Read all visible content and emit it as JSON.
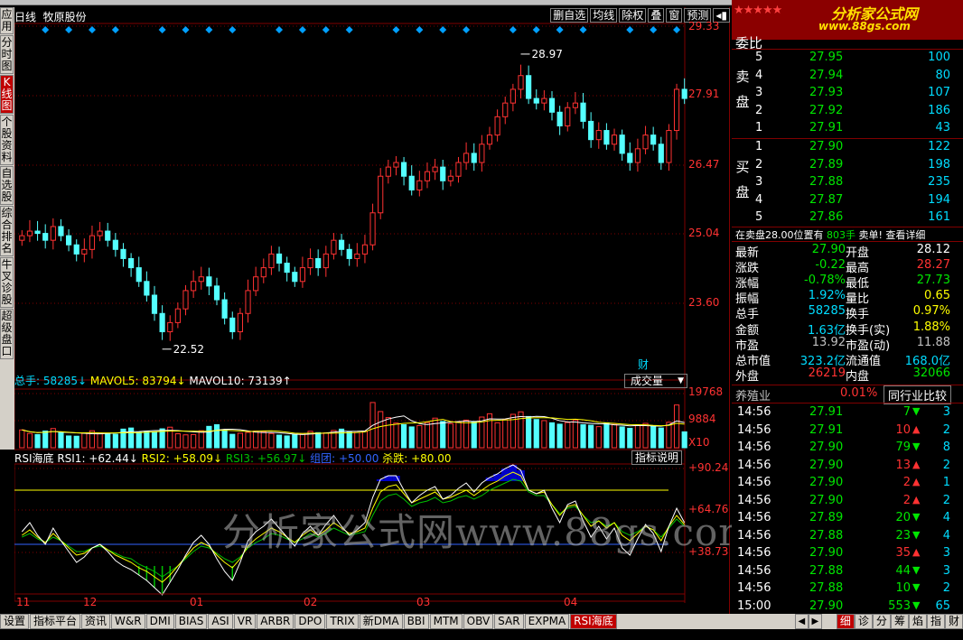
{
  "stock": {
    "period": "日线",
    "name": "牧原股份"
  },
  "left_tabs": [
    {
      "label": "应用",
      "active": false
    },
    {
      "label": "分时图",
      "active": false
    },
    {
      "label": "K线图",
      "active": true
    },
    {
      "label": "个股资料",
      "active": false
    },
    {
      "label": "自选股",
      "active": false
    },
    {
      "label": "综合排名",
      "active": false
    },
    {
      "label": "牛叉诊股",
      "active": false
    },
    {
      "label": "超级盘口",
      "active": false
    }
  ],
  "toolbar": [
    "删自选",
    "均线",
    "除权",
    "叠",
    "窗",
    "预测",
    "◂▮"
  ],
  "price_axis": [
    "29.33",
    "27.91",
    "26.47",
    "25.04",
    "23.60"
  ],
  "annotations": {
    "high": "28.97",
    "low": "22.52",
    "cai": "财"
  },
  "volume": {
    "header": [
      {
        "text": "总手: 58285↓",
        "color": "#00dcff"
      },
      {
        "text": " MAVOL5: 83794↓",
        "color": "#ffff00"
      },
      {
        "text": " MAVOL10: 73139↑",
        "color": "#ffffff"
      }
    ],
    "dropdown": "成交量",
    "axis": [
      "19768",
      "9884"
    ],
    "unit": "X10"
  },
  "rsi": {
    "header": [
      {
        "text": "RSI海底",
        "color": "#ffffff"
      },
      {
        "text": " RSI1: +62.44↓",
        "color": "#ffffff"
      },
      {
        "text": " RSI2: +58.09↓",
        "color": "#ffff00"
      },
      {
        "text": " RSI3: +56.97↓",
        "color": "#00c000"
      },
      {
        "text": " 组团: +50.00",
        "color": "#3264ff"
      },
      {
        "text": " 杀跌: +80.00",
        "color": "#ffff00"
      }
    ],
    "help": "指标说明",
    "axis": [
      "+90.24",
      "+64.76",
      "+38.73"
    ]
  },
  "watermark": "分析家公式网www.88gs.com",
  "dates": [
    "11",
    "12",
    "01",
    "02",
    "03",
    "04"
  ],
  "bottom_tabs": [
    "设置",
    "指标平台",
    "资讯",
    "W&R",
    "DMI",
    "BIAS",
    "ASI",
    "VR",
    "ARBR",
    "DPO",
    "TRIX",
    "新DMA",
    "BBI",
    "MTM",
    "OBV",
    "SAR",
    "EXPMA",
    "RSI海底"
  ],
  "right_tabs": [
    "细",
    "诊",
    "分",
    "筹",
    "焰",
    "指",
    "财"
  ],
  "logo": {
    "stars": "★★★★★",
    "name": "分析家公式网",
    "url": "www.88gs.com"
  },
  "order_book": {
    "weibi_label": "委比",
    "sell_label": "卖盘",
    "buy_label": "买盘",
    "sell": [
      {
        "lvl": "5",
        "price": "27.95",
        "vol": "100"
      },
      {
        "lvl": "4",
        "price": "27.94",
        "vol": "80"
      },
      {
        "lvl": "3",
        "price": "27.93",
        "vol": "107"
      },
      {
        "lvl": "2",
        "price": "27.92",
        "vol": "186"
      },
      {
        "lvl": "1",
        "price": "27.91",
        "vol": "43"
      }
    ],
    "buy": [
      {
        "lvl": "1",
        "price": "27.90",
        "vol": "122"
      },
      {
        "lvl": "2",
        "price": "27.89",
        "vol": "198"
      },
      {
        "lvl": "3",
        "price": "27.88",
        "vol": "235"
      },
      {
        "lvl": "4",
        "price": "27.87",
        "vol": "194"
      },
      {
        "lvl": "5",
        "price": "27.86",
        "vol": "161"
      }
    ],
    "note_a": "在卖盘28.00位置有",
    "note_b": "803手",
    "note_c": "卖单! 查看详细"
  },
  "quote": [
    {
      "l1": "最新",
      "v1": "27.90",
      "c1": "#00e600",
      "l2": "开盘",
      "v2": "28.12",
      "c2": "#ffffff"
    },
    {
      "l1": "涨跌",
      "v1": "-0.22",
      "c1": "#00e600",
      "l2": "最高",
      "v2": "28.27",
      "c2": "#ff3232"
    },
    {
      "l1": "涨幅",
      "v1": "-0.78%",
      "c1": "#00e600",
      "l2": "最低",
      "v2": "27.73",
      "c2": "#00e600"
    },
    {
      "l1": "振幅",
      "v1": "1.92%",
      "c1": "#00dcff",
      "l2": "量比",
      "v2": "0.65",
      "c2": "#ffff00"
    },
    {
      "l1": "总手",
      "v1": "58285",
      "c1": "#00dcff",
      "l2": "换手",
      "v2": "0.97%",
      "c2": "#ffff00"
    },
    {
      "l1": "金额",
      "v1": "1.63亿",
      "c1": "#00dcff",
      "l2": "换手(实)",
      "v2": "1.88%",
      "c2": "#ffff00"
    },
    {
      "l1": "市盈",
      "v1": "13.92",
      "c1": "#c0c0c0",
      "l2": "市盈(动)",
      "v2": "11.88",
      "c2": "#c0c0c0"
    },
    {
      "l1": "总市值",
      "v1": "323.2亿",
      "c1": "#00dcff",
      "l2": "流通值",
      "v2": "168.0亿",
      "c2": "#00dcff"
    },
    {
      "l1": "外盘",
      "v1": "26219",
      "c1": "#ff3232",
      "l2": "内盘",
      "v2": "32066",
      "c2": "#00e600"
    }
  ],
  "industry": {
    "name": "养殖业",
    "change": "0.01%",
    "button": "同行业比较"
  },
  "ticks": [
    {
      "t": "14:56",
      "p": "27.91",
      "v": "7",
      "dir": "down",
      "n": "3"
    },
    {
      "t": "14:56",
      "p": "27.91",
      "v": "10",
      "dir": "up",
      "n": "2"
    },
    {
      "t": "14:56",
      "p": "27.90",
      "v": "79",
      "dir": "down",
      "n": "8"
    },
    {
      "t": "14:56",
      "p": "27.90",
      "v": "13",
      "dir": "up",
      "n": "2"
    },
    {
      "t": "14:56",
      "p": "27.90",
      "v": "2",
      "dir": "up",
      "n": "1"
    },
    {
      "t": "14:56",
      "p": "27.90",
      "v": "2",
      "dir": "up",
      "n": "2"
    },
    {
      "t": "14:56",
      "p": "27.89",
      "v": "20",
      "dir": "down",
      "n": "4"
    },
    {
      "t": "14:56",
      "p": "27.88",
      "v": "23",
      "dir": "down",
      "n": "4"
    },
    {
      "t": "14:56",
      "p": "27.90",
      "v": "35",
      "dir": "up",
      "n": "3"
    },
    {
      "t": "14:56",
      "p": "27.88",
      "v": "44",
      "dir": "down",
      "n": "3"
    },
    {
      "t": "14:56",
      "p": "27.88",
      "v": "10",
      "dir": "down",
      "n": "2"
    },
    {
      "t": "15:00",
      "p": "27.90",
      "v": "553",
      "dir": "down",
      "n": "65"
    }
  ],
  "chart_data": {
    "type": "candlestick",
    "title": "牧原股份 日线",
    "price_range": [
      22.52,
      28.97
    ],
    "closes": [
      25.0,
      25.1,
      25.05,
      24.9,
      25.2,
      25.0,
      24.8,
      24.6,
      24.7,
      25.0,
      25.1,
      24.9,
      24.7,
      24.5,
      24.3,
      24.0,
      23.7,
      23.3,
      22.9,
      23.1,
      23.4,
      23.8,
      24.0,
      24.1,
      23.9,
      23.6,
      23.2,
      22.9,
      23.3,
      23.8,
      24.1,
      24.3,
      24.6,
      24.4,
      24.2,
      24.0,
      24.3,
      24.5,
      24.3,
      24.6,
      24.9,
      24.7,
      24.5,
      24.6,
      24.8,
      25.5,
      26.3,
      26.5,
      26.6,
      26.3,
      26.0,
      26.2,
      26.4,
      26.5,
      26.2,
      26.3,
      26.6,
      26.8,
      26.6,
      27.0,
      27.2,
      27.6,
      27.9,
      28.2,
      28.5,
      28.0,
      27.9,
      28.0,
      27.7,
      27.4,
      27.8,
      27.9,
      27.5,
      27.1,
      27.3,
      27.0,
      27.2,
      26.8,
      26.6,
      26.9,
      27.2,
      27.0,
      26.6,
      27.3,
      28.2,
      28.0
    ],
    "volumes": [
      6500,
      5200,
      4800,
      6100,
      7000,
      5500,
      4300,
      4200,
      5300,
      6200,
      5400,
      5000,
      4900,
      6800,
      7200,
      5600,
      6000,
      5800,
      6900,
      7500,
      5100,
      4700,
      4800,
      6200,
      7800,
      8400,
      6500,
      4900,
      5300,
      5600,
      6100,
      5900,
      5200,
      4600,
      4300,
      4800,
      5200,
      6000,
      5500,
      5400,
      6300,
      6800,
      5900,
      5600,
      6100,
      16500,
      13200,
      11000,
      9000,
      8400,
      7600,
      8100,
      9200,
      10800,
      9600,
      8800,
      9400,
      10100,
      9600,
      11200,
      12400,
      9100,
      10300,
      12200,
      13100,
      11400,
      10300,
      9900,
      9100,
      8600,
      9200,
      10100,
      8400,
      8200,
      7700,
      9100,
      8500,
      7600,
      7100,
      8200,
      8900,
      8000,
      7200,
      9300,
      15600,
      5800
    ],
    "rsi1": [
      57,
      62,
      55,
      50,
      59,
      52,
      46,
      40,
      43,
      48,
      50,
      46,
      41,
      38,
      36,
      33,
      30,
      26,
      22,
      29,
      36,
      44,
      51,
      55,
      50,
      42,
      35,
      30,
      40,
      52,
      57,
      60,
      64,
      59,
      54,
      49,
      56,
      60,
      55,
      61,
      66,
      60,
      55,
      58,
      62,
      76,
      86,
      88,
      88,
      80,
      73,
      77,
      80,
      82,
      75,
      77,
      81,
      84,
      79,
      84,
      87,
      89,
      92,
      94,
      91,
      80,
      78,
      80,
      70,
      62,
      72,
      74,
      63,
      54,
      60,
      53,
      59,
      48,
      44,
      53,
      61,
      56,
      46,
      60,
      70,
      62
    ],
    "rsi2": [
      55,
      58,
      54,
      51,
      56,
      52,
      48,
      44,
      45,
      48,
      50,
      47,
      44,
      42,
      40,
      37,
      35,
      32,
      29,
      33,
      38,
      43,
      48,
      51,
      49,
      44,
      40,
      37,
      42,
      49,
      53,
      56,
      59,
      57,
      54,
      51,
      55,
      58,
      55,
      58,
      62,
      59,
      56,
      57,
      59,
      70,
      79,
      82,
      83,
      78,
      73,
      75,
      77,
      79,
      75,
      76,
      78,
      80,
      77,
      80,
      83,
      85,
      88,
      90,
      88,
      80,
      78,
      79,
      72,
      66,
      71,
      72,
      66,
      60,
      63,
      59,
      62,
      55,
      52,
      56,
      60,
      58,
      52,
      60,
      66,
      61
    ],
    "rsi3": [
      54,
      56,
      53,
      51,
      54,
      52,
      49,
      46,
      46,
      48,
      49,
      47,
      45,
      43,
      42,
      39,
      37,
      35,
      32,
      35,
      38,
      42,
      46,
      49,
      48,
      45,
      42,
      40,
      43,
      48,
      51,
      53,
      56,
      55,
      53,
      51,
      53,
      56,
      54,
      56,
      59,
      57,
      55,
      56,
      57,
      66,
      74,
      77,
      78,
      75,
      71,
      73,
      74,
      76,
      73,
      74,
      76,
      77,
      75,
      77,
      80,
      82,
      84,
      86,
      85,
      79,
      77,
      77,
      72,
      67,
      70,
      71,
      66,
      62,
      63,
      60,
      62,
      57,
      55,
      57,
      60,
      58,
      54,
      59,
      64,
      60
    ],
    "rsi_levels": {
      "zutuan": 50,
      "shadie": 80
    },
    "rsi_range": [
      25,
      95
    ]
  },
  "colors": {
    "up": "#ff3232",
    "down": "#54ffff",
    "grid": "#800000",
    "ma5": "#ffffff",
    "ma10": "#ffff00",
    "rsi1": "#ffffff",
    "rsi2": "#ffff00",
    "rsi3": "#00c000",
    "zutuan": "#3264ff",
    "shadie": "#ffff00",
    "fill_top": "#0000c8",
    "fill_bottom": "#00c000"
  }
}
